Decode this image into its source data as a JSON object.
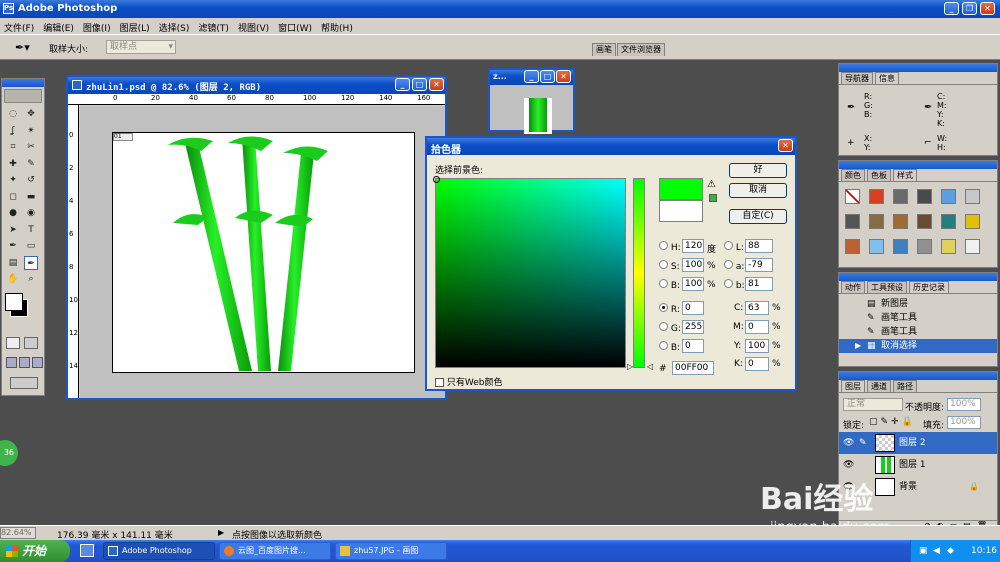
{
  "app": {
    "title": "Adobe Photoshop",
    "icon": "photoshop-icon"
  },
  "menu": [
    "文件(F)",
    "编辑(E)",
    "图像(I)",
    "图层(L)",
    "选择(S)",
    "滤镜(T)",
    "视图(V)",
    "窗口(W)",
    "帮助(H)"
  ],
  "options_bar": {
    "sample_label": "取样大小:",
    "sample_value": "取样点",
    "palette_tabs": [
      "画笔",
      "文件浏览器"
    ]
  },
  "document": {
    "title": "zhuLin1.psd @ 82.6% (图层 2, RGB)",
    "ruler_top": [
      "0",
      "20",
      "40",
      "60",
      "80",
      "100",
      "120",
      "140",
      "160"
    ],
    "ruler_left": [
      "0",
      "2",
      "4",
      "6",
      "8",
      "10",
      "12",
      "14"
    ],
    "thumb_title": "z..."
  },
  "color_picker": {
    "title": "拾色器",
    "prompt": "选择前景色:",
    "ok": "好",
    "cancel": "取消",
    "custom": "自定(C)",
    "hsb": [
      {
        "label": "H:",
        "value": "120",
        "unit": "度"
      },
      {
        "label": "S:",
        "value": "100",
        "unit": "%"
      },
      {
        "label": "B:",
        "value": "100",
        "unit": "%"
      }
    ],
    "lab": [
      {
        "label": "L:",
        "value": "88"
      },
      {
        "label": "a:",
        "value": "-79"
      },
      {
        "label": "b:",
        "value": "81"
      }
    ],
    "rgb": [
      {
        "label": "R:",
        "value": "0"
      },
      {
        "label": "G:",
        "value": "255"
      },
      {
        "label": "B:",
        "value": "0"
      }
    ],
    "cmyk": [
      {
        "label": "C:",
        "value": "63",
        "unit": "%"
      },
      {
        "label": "M:",
        "value": "0",
        "unit": "%"
      },
      {
        "label": "Y:",
        "value": "100",
        "unit": "%"
      },
      {
        "label": "K:",
        "value": "0",
        "unit": "%"
      }
    ],
    "hex_label": "#",
    "hex": "00FF00",
    "web_only": "只有Web颜色",
    "new_color": "#00ff00",
    "old_color": "#ffffff"
  },
  "navigator": {
    "tabs": [
      "导航器",
      "信息"
    ],
    "rgb": "R:\nG:\nB:",
    "cmyk": "C:\nM:\nY:\nK:",
    "xy": "X:\nY:",
    "wh": "W:\nH:"
  },
  "swatches_panel": {
    "tabs": [
      "颜色",
      "色板",
      "样式"
    ]
  },
  "history": {
    "tabs": [
      "动作",
      "工具预设",
      "历史记录"
    ],
    "items": [
      "新图层",
      "画笔工具",
      "画笔工具",
      "取消选择"
    ]
  },
  "layers": {
    "tabs": [
      "图层",
      "通道",
      "路径"
    ],
    "blend": "正常",
    "opacity_label": "不透明度:",
    "opacity": "100%",
    "lock_label": "锁定:",
    "fill_label": "填充:",
    "fill": "100%",
    "items": [
      "图层 2",
      "图层 1",
      "背景"
    ]
  },
  "status": {
    "zoom": "82.64%",
    "size": "176.39 毫米 x 141.11 毫米",
    "hint": "点按图像以选取新颜色"
  },
  "taskbar": {
    "start": "开始",
    "items": [
      "Adobe Photoshop",
      "云图_百度图片搜...",
      "zhu57.JPG - 画图"
    ],
    "clock": "10:16"
  },
  "watermark": {
    "brand": "Bai经验",
    "url": "jingyan.baidu.com"
  },
  "badge": "36"
}
